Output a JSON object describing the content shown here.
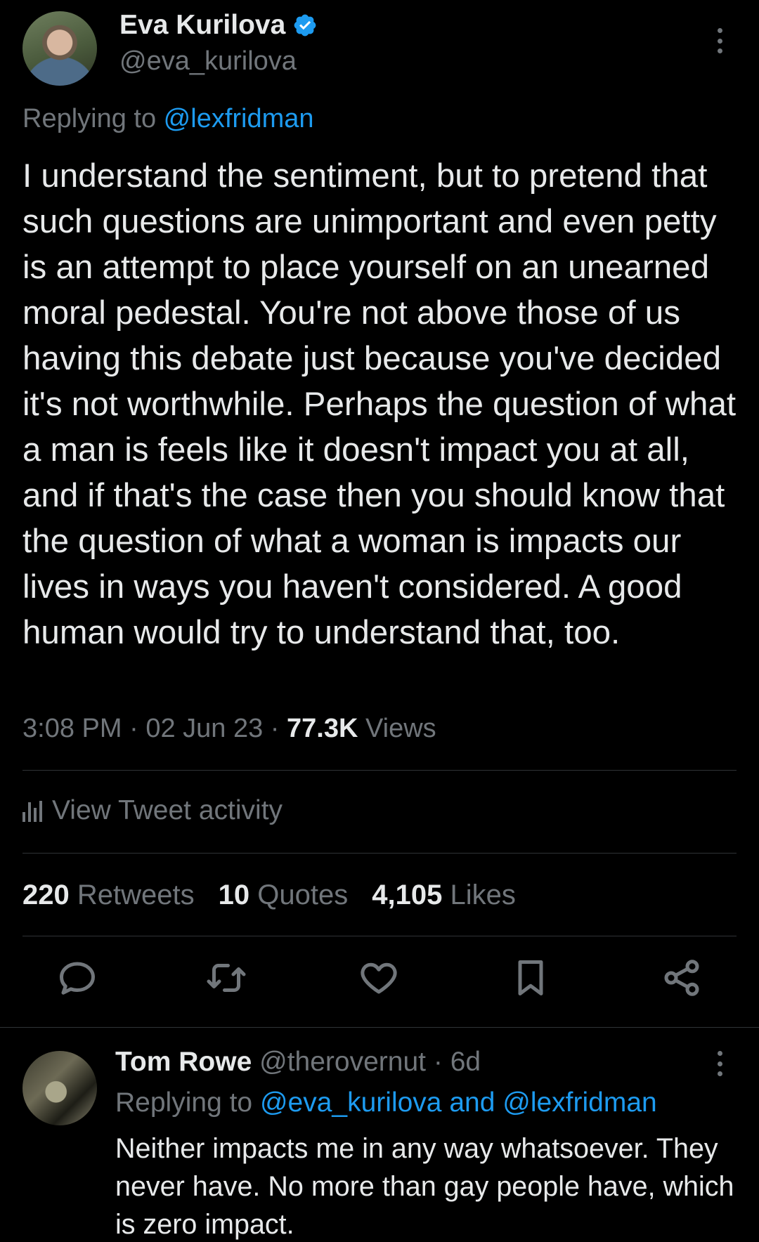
{
  "tweet": {
    "author_name": "Eva Kurilova",
    "author_handle": "@eva_kurilova",
    "replying_prefix": "Replying to ",
    "replying_to": "@lexfridman",
    "text": "I understand the sentiment, but to pretend that such questions are unimportant and even petty is an attempt to place yourself on an unearned moral pedestal. You're not above those of us having this debate just because you've decided it's not worthwhile. Perhaps the question of what a man is feels like it doesn't impact you at all, and if that's the case then you should know that the question of what a woman is impacts our lives in ways you haven't considered. A good human would try to understand that, too.",
    "time": "3:08 PM",
    "date": "02 Jun 23",
    "views_count": "77.3K",
    "views_label": " Views",
    "activity_label": "View Tweet activity",
    "retweets_count": "220",
    "retweets_label": "Retweets",
    "quotes_count": "10",
    "quotes_label": "Quotes",
    "likes_count": "4,105",
    "likes_label": "Likes"
  },
  "reply": {
    "author_name": "Tom Rowe",
    "author_handle": "@therovernut",
    "age": "6d",
    "replying_prefix": "Replying to ",
    "replying_to": "@eva_kurilova and @lexfridman",
    "text": "Neither impacts me in any way whatsoever. They never have. No more than gay people have, which is zero impact."
  },
  "icons": {
    "verified": "verified-badge-icon",
    "more": "more-vertical-icon",
    "activity": "bar-chart-icon",
    "reply": "reply-icon",
    "retweet": "retweet-icon",
    "like": "heart-icon",
    "bookmark": "bookmark-icon",
    "share": "share-icon"
  },
  "colors": {
    "background": "#000000",
    "text": "#e7e9ea",
    "muted": "#71767b",
    "accent": "#1d9bf0",
    "divider": "#2f3336"
  }
}
